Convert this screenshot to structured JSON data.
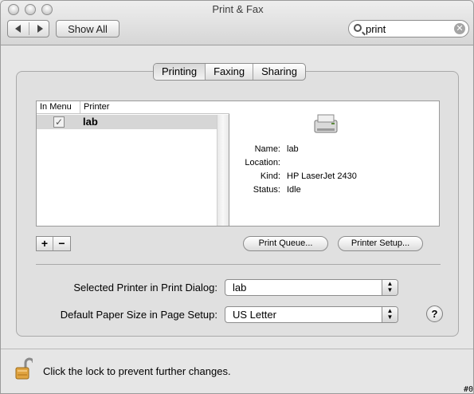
{
  "window": {
    "title": "Print & Fax"
  },
  "toolbar": {
    "show_all_label": "Show All",
    "search_value": "print"
  },
  "tabs": [
    {
      "label": "Printing",
      "selected": true
    },
    {
      "label": "Faxing",
      "selected": false
    },
    {
      "label": "Sharing",
      "selected": false
    }
  ],
  "printer_list": {
    "columns": [
      "In Menu",
      "Printer"
    ],
    "rows": [
      {
        "in_menu": true,
        "printer": "lab"
      }
    ]
  },
  "details": {
    "name_label": "Name:",
    "name_value": "lab",
    "location_label": "Location:",
    "location_value": "",
    "kind_label": "Kind:",
    "kind_value": "HP LaserJet 2430",
    "status_label": "Status:",
    "status_value": "Idle"
  },
  "buttons": {
    "add": "+",
    "remove": "−",
    "print_queue": "Print Queue...",
    "printer_setup": "Printer Setup..."
  },
  "settings": {
    "selected_printer_label": "Selected Printer in Print Dialog:",
    "selected_printer_value": "lab",
    "paper_size_label": "Default Paper Size in Page Setup:",
    "paper_size_value": "US Letter"
  },
  "help_label": "?",
  "lock": {
    "text": "Click the lock to prevent further changes."
  },
  "corner_mark": "#0"
}
